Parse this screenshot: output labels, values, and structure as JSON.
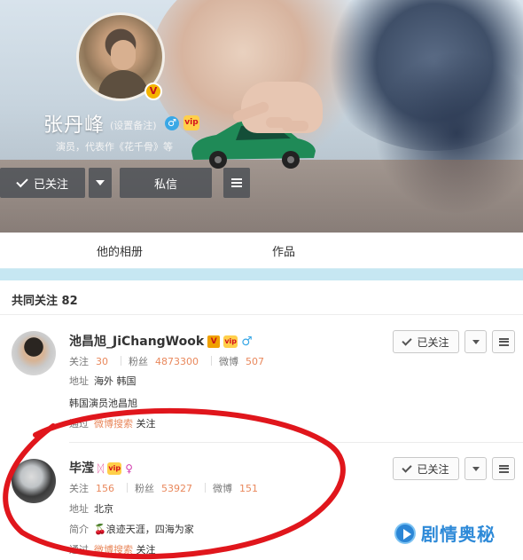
{
  "profile": {
    "name": "张丹峰",
    "remark": "(设置备注)",
    "verified_badge": "V",
    "vip_badge": "vip",
    "gender_icon": "♂",
    "description": "演员，代表作《花千骨》等",
    "follow_label": "已关注",
    "message_label": "私信"
  },
  "tabs": [
    {
      "label": "他的相册"
    },
    {
      "label": "作品"
    }
  ],
  "common_follows": {
    "title": "共同关注",
    "count": "82",
    "users": [
      {
        "name": "池昌旭_JiChangWook",
        "follow_label": "关注",
        "follow_count": "30",
        "fans_label": "粉丝",
        "fans_count": "4873300",
        "weibo_label": "微博",
        "weibo_count": "507",
        "location_label": "地址",
        "location": "海外 韩国",
        "intro": "韩国演员池昌旭",
        "via_label": "通过",
        "via_link": "微博搜索",
        "via_suffix": "关注",
        "button_label": "已关注"
      },
      {
        "name": "毕滢",
        "follow_label": "关注",
        "follow_count": "156",
        "fans_label": "粉丝",
        "fans_count": "53927",
        "weibo_label": "微博",
        "weibo_count": "151",
        "location_label": "地址",
        "location": "北京",
        "intro_label": "简介",
        "intro": "🍒浪迹天涯，四海为家",
        "via_label": "通过",
        "via_link": "微博搜索",
        "via_suffix": "关注",
        "button_label": "已关注"
      }
    ]
  },
  "watermark": {
    "text": "剧情奥秘"
  },
  "colors": {
    "accent_orange": "#e9885c",
    "strip_blue": "#c6e7f2",
    "circle_red": "#e0161c"
  }
}
